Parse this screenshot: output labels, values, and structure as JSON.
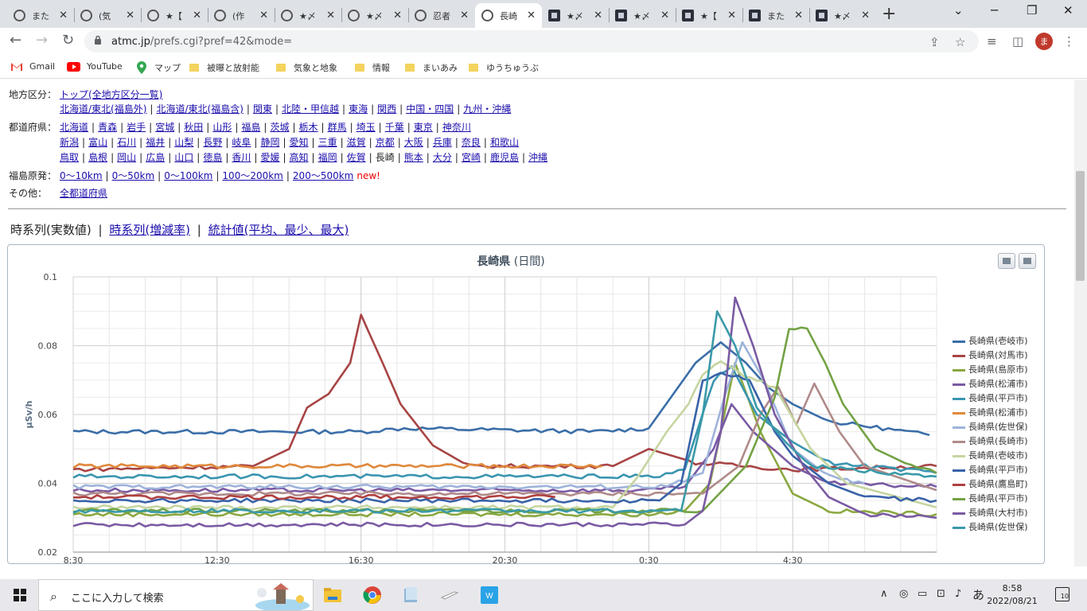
{
  "browser": {
    "tabs": [
      {
        "title": "また",
        "icon": "globe-icon"
      },
      {
        "title": "(気",
        "icon": "globe-icon"
      },
      {
        "title": "★【",
        "icon": "globe-icon"
      },
      {
        "title": "(作",
        "icon": "globe-icon"
      },
      {
        "title": "★〆",
        "icon": "globe-icon"
      },
      {
        "title": "★〆",
        "icon": "globe-icon"
      },
      {
        "title": "忍者",
        "icon": "globe-icon"
      },
      {
        "title": "長崎",
        "icon": "globe-icon",
        "active": true
      },
      {
        "title": "★〆",
        "icon": "site-icon"
      },
      {
        "title": "★〆",
        "icon": "site-icon"
      },
      {
        "title": "★【",
        "icon": "site-icon"
      },
      {
        "title": "また",
        "icon": "site-icon"
      },
      {
        "title": "★〆",
        "icon": "site-icon"
      }
    ],
    "url_host": "atmc.jp",
    "url_path": "/prefs.cgi?pref=42&mode=",
    "avatar_letter": "ま",
    "bookmarks": [
      {
        "label": "Gmail",
        "icon": "gmail-icon"
      },
      {
        "label": "YouTube",
        "icon": "youtube-icon"
      },
      {
        "label": "マップ",
        "icon": "maps-icon"
      },
      {
        "label": "被曝と放射能",
        "icon": "folder-icon"
      },
      {
        "label": "気象と地象",
        "icon": "folder-icon"
      },
      {
        "label": "情報",
        "icon": "folder-icon"
      },
      {
        "label": "まいあみ",
        "icon": "folder-icon"
      },
      {
        "label": "ゆうちゅうぶ",
        "icon": "folder-icon"
      }
    ]
  },
  "nav": {
    "region_label": "地方区分：",
    "region_top": "トップ(全地方区分一覧)",
    "regions": [
      "北海道/東北(福島外)",
      "北海道/東北(福島含)",
      "関東",
      "北陸・甲信越",
      "東海",
      "関西",
      "中国・四国",
      "九州・沖縄"
    ],
    "pref_label": "都道府県：",
    "prefs_line1": [
      "北海道",
      "青森",
      "岩手",
      "宮城",
      "秋田",
      "山形",
      "福島",
      "茨城",
      "栃木",
      "群馬",
      "埼玉",
      "千葉",
      "東京",
      "神奈川"
    ],
    "prefs_line2": [
      "新潟",
      "富山",
      "石川",
      "福井",
      "山梨",
      "長野",
      "岐阜",
      "静岡",
      "愛知",
      "三重",
      "滋賀",
      "京都",
      "大阪",
      "兵庫",
      "奈良",
      "和歌山"
    ],
    "prefs_line3": [
      "鳥取",
      "島根",
      "岡山",
      "広島",
      "山口",
      "徳島",
      "香川",
      "愛媛",
      "高知",
      "福岡",
      "佐賀",
      "長崎",
      "熊本",
      "大分",
      "宮崎",
      "鹿児島",
      "沖縄"
    ],
    "current_pref": "長崎",
    "fukushima_label": "福島原発：",
    "fukushima": [
      "0〜10km",
      "0〜50km",
      "0〜100km",
      "100〜200km",
      "200〜500km"
    ],
    "new_tag": "new!",
    "other_label": "その他：",
    "other_link": "全都道府県"
  },
  "view_tabs": {
    "current": "時系列(実数値)",
    "links": [
      "時系列(増減率)",
      "統計値(平均、最少、最大)"
    ]
  },
  "chart_data": {
    "type": "line",
    "title_main": "長崎県",
    "title_sub": "(日間)",
    "ylabel": "μSv/h",
    "ylim": [
      0.02,
      0.1
    ],
    "yticks": [
      "0.02",
      "0.04",
      "0.06",
      "0.08",
      "0.1"
    ],
    "xlim": [
      8.5,
      32.5
    ],
    "xticks": [
      {
        "x": 8.5,
        "label": "8:30"
      },
      {
        "x": 12.5,
        "label": "12:30"
      },
      {
        "x": 16.5,
        "label": "16:30"
      },
      {
        "x": 20.5,
        "label": "20:30"
      },
      {
        "x": 24.5,
        "label": "0:30"
      },
      {
        "x": 28.5,
        "label": "4:30"
      }
    ],
    "grid": true,
    "legend_position": "right",
    "series": [
      {
        "name": "長崎県(壱岐市)",
        "color": "#3a6ea8",
        "points": [
          [
            8.5,
            0.055
          ],
          [
            16.5,
            0.055
          ],
          [
            17.7,
            0.056
          ],
          [
            23,
            0.055
          ],
          [
            24.5,
            0.056
          ],
          [
            25.8,
            0.075
          ],
          [
            26.5,
            0.081
          ],
          [
            27.2,
            0.075
          ],
          [
            27.8,
            0.068
          ],
          [
            28.5,
            0.063
          ],
          [
            29.5,
            0.058
          ],
          [
            31,
            0.056
          ],
          [
            32.3,
            0.054
          ]
        ]
      },
      {
        "name": "長崎県(対馬市)",
        "color": "#a84444",
        "points": [
          [
            8.5,
            0.044
          ],
          [
            13.5,
            0.045
          ],
          [
            14.5,
            0.05
          ],
          [
            15,
            0.062
          ],
          [
            15.6,
            0.066
          ],
          [
            16.2,
            0.075
          ],
          [
            16.5,
            0.089
          ],
          [
            17.1,
            0.075
          ],
          [
            17.6,
            0.063
          ],
          [
            18.5,
            0.051
          ],
          [
            19.5,
            0.045
          ],
          [
            23.5,
            0.045
          ],
          [
            24.5,
            0.05
          ],
          [
            25.8,
            0.046
          ],
          [
            28.5,
            0.044
          ],
          [
            32.5,
            0.045
          ]
        ]
      },
      {
        "name": "長崎県(島原市)",
        "color": "#8aa840",
        "points": [
          [
            8.5,
            0.031
          ],
          [
            24.5,
            0.031
          ],
          [
            25.5,
            0.032
          ],
          [
            26.2,
            0.04
          ],
          [
            26.9,
            0.075
          ],
          [
            27.6,
            0.055
          ],
          [
            28.5,
            0.037
          ],
          [
            29.5,
            0.032
          ],
          [
            32.5,
            0.031
          ]
        ]
      },
      {
        "name": "長崎県(松浦市)",
        "color": "#7a5aa3",
        "points": [
          [
            8.5,
            0.038
          ],
          [
            24.5,
            0.038
          ],
          [
            25.5,
            0.039
          ],
          [
            26.3,
            0.05
          ],
          [
            26.8,
            0.063
          ],
          [
            27.4,
            0.055
          ],
          [
            28.5,
            0.045
          ],
          [
            29.5,
            0.04
          ],
          [
            32.5,
            0.039
          ]
        ]
      },
      {
        "name": "長崎県(平戸市)",
        "color": "#3a95b0",
        "points": [
          [
            8.5,
            0.042
          ],
          [
            24.8,
            0.042
          ],
          [
            25.5,
            0.044
          ],
          [
            26.3,
            0.07
          ],
          [
            26.8,
            0.074
          ],
          [
            27.5,
            0.06
          ],
          [
            28.5,
            0.052
          ],
          [
            29.5,
            0.046
          ],
          [
            32.5,
            0.043
          ]
        ]
      },
      {
        "name": "長崎県(松浦市)",
        "color": "#e0883a",
        "points": [
          [
            8.5,
            0.045
          ],
          [
            23.2,
            0.045
          ]
        ]
      },
      {
        "name": "長崎県(佐世保)",
        "color": "#9db3da",
        "points": [
          [
            8.5,
            0.039
          ],
          [
            25,
            0.039
          ],
          [
            26,
            0.043
          ],
          [
            26.6,
            0.065
          ],
          [
            27.1,
            0.081
          ],
          [
            27.7,
            0.07
          ],
          [
            28.5,
            0.05
          ],
          [
            29.5,
            0.042
          ],
          [
            30.5,
            0.04
          ]
        ]
      },
      {
        "name": "長崎県(長崎市)",
        "color": "#b08a8a",
        "points": [
          [
            8.5,
            0.037
          ],
          [
            26,
            0.037
          ],
          [
            27,
            0.045
          ],
          [
            27.6,
            0.06
          ],
          [
            28.1,
            0.068
          ],
          [
            28.6,
            0.057
          ],
          [
            29.1,
            0.069
          ],
          [
            29.8,
            0.055
          ],
          [
            30.5,
            0.045
          ],
          [
            32.5,
            0.038
          ]
        ]
      },
      {
        "name": "長崎県(壱岐市)",
        "color": "#c5d5a0",
        "points": [
          [
            8.5,
            0.033
          ],
          [
            23.5,
            0.033
          ],
          [
            24.2,
            0.042
          ],
          [
            25,
            0.055
          ],
          [
            25.6,
            0.063
          ],
          [
            26,
            0.072
          ],
          [
            26.5,
            0.075
          ],
          [
            27,
            0.072
          ],
          [
            28,
            0.068
          ],
          [
            29,
            0.05
          ],
          [
            30,
            0.04
          ],
          [
            32.5,
            0.033
          ]
        ]
      },
      {
        "name": "長崎県(平戸市)",
        "color": "#3862a8",
        "points": [
          [
            8.5,
            0.035
          ],
          [
            24.8,
            0.035
          ],
          [
            25.4,
            0.04
          ],
          [
            26,
            0.07
          ],
          [
            26.5,
            0.072
          ],
          [
            27.3,
            0.07
          ],
          [
            28,
            0.055
          ],
          [
            28.5,
            0.048
          ],
          [
            29.5,
            0.04
          ],
          [
            30.5,
            0.036
          ],
          [
            32.5,
            0.035
          ]
        ]
      },
      {
        "name": "長崎県(鷹島町)",
        "color": "#b04040",
        "points": [
          [
            8.5,
            0.036
          ],
          [
            21.9,
            0.036
          ]
        ]
      },
      {
        "name": "長崎県(平戸市)",
        "color": "#73a244",
        "points": [
          [
            8.5,
            0.032
          ],
          [
            26,
            0.032
          ],
          [
            27.2,
            0.045
          ],
          [
            28,
            0.065
          ],
          [
            28.4,
            0.085
          ],
          [
            28.9,
            0.085
          ],
          [
            29.4,
            0.075
          ],
          [
            29.9,
            0.063
          ],
          [
            30.8,
            0.05
          ],
          [
            31.8,
            0.045
          ],
          [
            32.5,
            0.043
          ]
        ]
      },
      {
        "name": "長崎県(大村市)",
        "color": "#7a5aa3",
        "points": [
          [
            8.5,
            0.028
          ],
          [
            25.5,
            0.028
          ],
          [
            26,
            0.032
          ],
          [
            26.5,
            0.055
          ],
          [
            26.9,
            0.094
          ],
          [
            27.4,
            0.08
          ],
          [
            28,
            0.06
          ],
          [
            28.8,
            0.045
          ],
          [
            29.5,
            0.036
          ],
          [
            30.5,
            0.031
          ],
          [
            32.5,
            0.03
          ]
        ]
      },
      {
        "name": "長崎県(佐世保)",
        "color": "#3a9aa8",
        "points": [
          [
            8.5,
            0.032
          ],
          [
            25.4,
            0.032
          ],
          [
            26,
            0.06
          ],
          [
            26.4,
            0.09
          ],
          [
            26.9,
            0.08
          ],
          [
            27.5,
            0.062
          ],
          [
            28.3,
            0.052
          ],
          [
            29,
            0.045
          ],
          [
            30,
            0.044
          ],
          [
            32.5,
            0.042
          ]
        ]
      }
    ]
  }
}
